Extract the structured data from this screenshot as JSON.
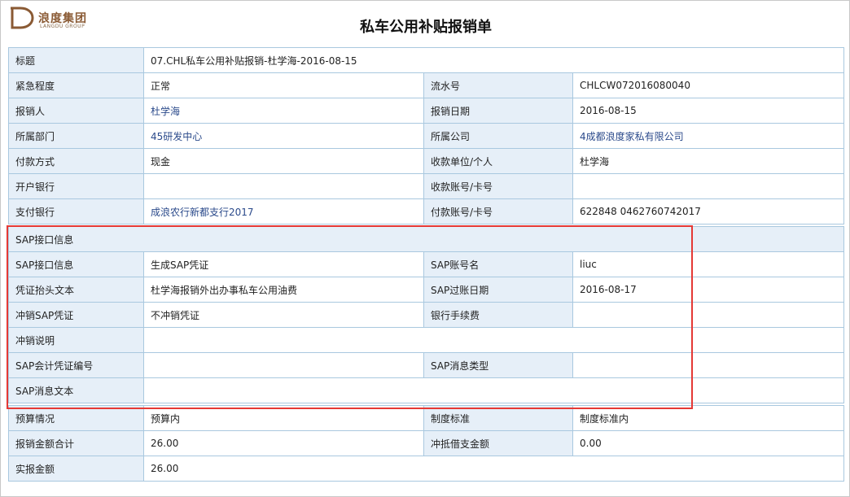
{
  "brand": {
    "cn_name": "浪度集团",
    "en_name": "LANGDU GROUP",
    "mark_letter": "D",
    "color": "#8a5a34"
  },
  "title": "私车公用补贴报销单",
  "basic": {
    "subject_label": "标题",
    "subject_value": "07.CHL私车公用补贴报销-杜学海-2016-08-15",
    "rows": [
      {
        "l1": "紧急程度",
        "v1": "正常",
        "l2": "流水号",
        "v2": "CHLCW072016080040"
      },
      {
        "l1": "报销人",
        "v1": "杜学海",
        "l2": "报销日期",
        "v2": "2016-08-15"
      },
      {
        "l1": "所属部门",
        "v1": "45研发中心",
        "l2": "所属公司",
        "v2": "4成都浪度家私有限公司"
      },
      {
        "l1": "付款方式",
        "v1": "现金",
        "l2": "收款单位/个人",
        "v2": "杜学海"
      },
      {
        "l1": "开户银行",
        "v1": "",
        "l2": "收款账号/卡号",
        "v2": ""
      },
      {
        "l1": "支付银行",
        "v1": "成浪农行新都支行2017",
        "l2": "付款账号/卡号",
        "v2": "622848 0462760742017"
      }
    ]
  },
  "sap": {
    "section_title": "SAP接口信息",
    "rows": [
      {
        "l1": "SAP接口信息",
        "v1": "生成SAP凭证",
        "l2": "SAP账号名",
        "v2": "liuc"
      },
      {
        "l1": "凭证抬头文本",
        "v1": "杜学海报销外出办事私车公用油费",
        "l2": "SAP过账日期",
        "v2": "2016-08-17"
      },
      {
        "l1": "冲销SAP凭证",
        "v1": "不冲销凭证",
        "l2": "银行手续费",
        "v2": ""
      }
    ],
    "reversal_note_label": "冲销说明",
    "reversal_note_value": "",
    "doc_no_label": "SAP会计凭证编号",
    "doc_no_value": "",
    "msg_type_label": "SAP消息类型",
    "msg_type_value": "",
    "msg_text_label": "SAP消息文本",
    "msg_text_value": ""
  },
  "budget": {
    "rows": [
      {
        "l1": "预算情况",
        "v1": "预算内",
        "l2": "制度标准",
        "v2": "制度标准内"
      },
      {
        "l1": "报销金额合计",
        "v1": "26.00",
        "l2": "冲抵借支金额",
        "v2": "0.00"
      }
    ],
    "actual_label": "实报金额",
    "actual_value": "26.00"
  },
  "colors": {
    "label_bg": "#e6eff8",
    "border": "#a9c8df",
    "link": "#2b4a8b",
    "highlight": "#e53935"
  }
}
